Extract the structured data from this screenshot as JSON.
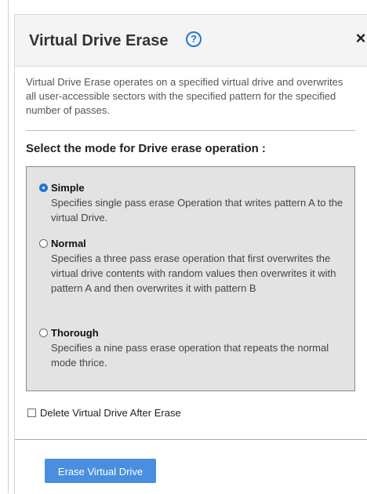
{
  "dialog": {
    "title": "Virtual Drive Erase",
    "help_icon": "help-icon",
    "help_glyph": "?",
    "close_icon": "close-icon",
    "close_glyph": "×",
    "description": "Virtual Drive Erase operates on a specified virtual drive and overwrites all user-accessible sectors with the specified pattern for the specified number of passes.",
    "mode_heading": "Select the mode for Drive erase operation :",
    "modes": [
      {
        "label": "Simple",
        "description": "Specifies single pass erase Operation that writes pattern A to the virtual Drive.",
        "selected": true
      },
      {
        "label": "Normal",
        "description": "Specifies a three pass erase operation that first overwrites the virtual drive contents with random values then overwrites it with pattern A and then overwrites it with pattern B",
        "selected": false
      },
      {
        "label": "Thorough",
        "description": "Specifies a nine pass erase operation that repeats the normal mode thrice.",
        "selected": false
      }
    ],
    "delete_checkbox_label": "Delete Virtual Drive After Erase",
    "delete_checkbox_checked": false,
    "erase_button_label": "Erase Virtual Drive"
  },
  "colors": {
    "accent": "#1f78d1",
    "button": "#4a8fdf",
    "header_bg": "#f4f4f4",
    "mode_box_bg": "#e3e3e3"
  }
}
